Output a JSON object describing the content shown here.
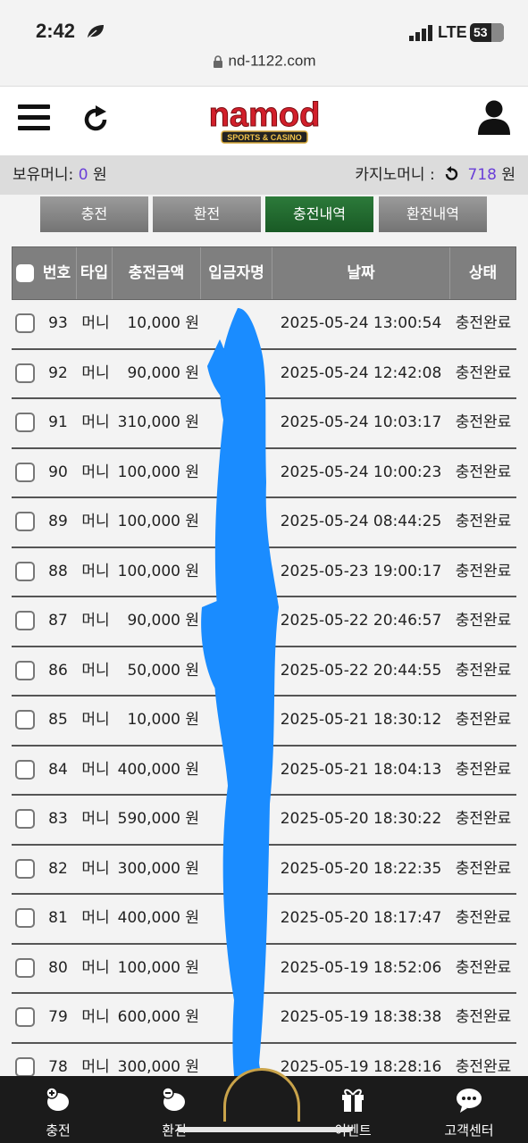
{
  "status_bar": {
    "time": "2:42",
    "network": "LTE",
    "battery": "53"
  },
  "browser": {
    "url": "nd-1122.com"
  },
  "header": {
    "logo_text": "namod",
    "logo_sub": "SPORTS & CASINO"
  },
  "money": {
    "holding_label": "보유머니:",
    "holding_value": "0",
    "holding_unit": "원",
    "casino_label": "카지노머니 :",
    "casino_value": "718",
    "casino_unit": "원"
  },
  "tabs": [
    "충전",
    "환전",
    "충전내역",
    "환전내역"
  ],
  "table": {
    "headers": {
      "no": "번호",
      "type": "타입",
      "amount": "충전금액",
      "depositor": "입금자명",
      "date": "날짜",
      "status": "상태"
    },
    "rows": [
      {
        "no": "93",
        "type": "머니",
        "amount": "10,000 원",
        "date": "2025-05-24 13:00:54",
        "status": "충전완료"
      },
      {
        "no": "92",
        "type": "머니",
        "amount": "90,000 원",
        "date": "2025-05-24 12:42:08",
        "status": "충전완료"
      },
      {
        "no": "91",
        "type": "머니",
        "amount": "310,000 원",
        "date": "2025-05-24 10:03:17",
        "status": "충전완료"
      },
      {
        "no": "90",
        "type": "머니",
        "amount": "100,000 원",
        "date": "2025-05-24 10:00:23",
        "status": "충전완료"
      },
      {
        "no": "89",
        "type": "머니",
        "amount": "100,000 원",
        "date": "2025-05-24 08:44:25",
        "status": "충전완료"
      },
      {
        "no": "88",
        "type": "머니",
        "amount": "100,000 원",
        "date": "2025-05-23 19:00:17",
        "status": "충전완료"
      },
      {
        "no": "87",
        "type": "머니",
        "amount": "90,000 원",
        "date": "2025-05-22 20:46:57",
        "status": "충전완료"
      },
      {
        "no": "86",
        "type": "머니",
        "amount": "50,000 원",
        "date": "2025-05-22 20:44:55",
        "status": "충전완료"
      },
      {
        "no": "85",
        "type": "머니",
        "amount": "10,000 원",
        "date": "2025-05-21 18:30:12",
        "status": "충전완료"
      },
      {
        "no": "84",
        "type": "머니",
        "amount": "400,000 원",
        "date": "2025-05-21 18:04:13",
        "status": "충전완료"
      },
      {
        "no": "83",
        "type": "머니",
        "amount": "590,000 원",
        "date": "2025-05-20 18:30:22",
        "status": "충전완료"
      },
      {
        "no": "82",
        "type": "머니",
        "amount": "300,000 원",
        "date": "2025-05-20 18:22:35",
        "status": "충전완료"
      },
      {
        "no": "81",
        "type": "머니",
        "amount": "400,000 원",
        "date": "2025-05-20 18:17:47",
        "status": "충전완료"
      },
      {
        "no": "80",
        "type": "머니",
        "amount": "100,000 원",
        "date": "2025-05-19 18:52:06",
        "status": "충전완료"
      },
      {
        "no": "79",
        "type": "머니",
        "amount": "600,000 원",
        "date": "2025-05-19 18:38:38",
        "status": "충전완료"
      },
      {
        "no": "78",
        "type": "머니",
        "amount": "300,000 원",
        "date": "2025-05-19 18:28:16",
        "status": "충전완료"
      }
    ]
  },
  "bottom_nav": [
    {
      "label": "충전",
      "icon": "deposit-icon"
    },
    {
      "label": "환전",
      "icon": "withdraw-icon"
    },
    {
      "label": "",
      "icon": "home-icon"
    },
    {
      "label": "이벤트",
      "icon": "gift-icon"
    },
    {
      "label": "고객센터",
      "icon": "support-icon"
    }
  ],
  "colors": {
    "accent_purple": "#6a3fd8",
    "active_tab": "#1f6a2e",
    "scribble": "#1a8cff"
  }
}
